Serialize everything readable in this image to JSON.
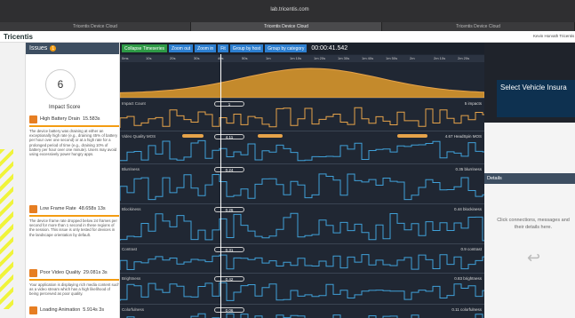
{
  "browser": {
    "url": "lab.tricentis.com",
    "tabs": [
      "Tricentis Device Cloud",
      "Tricentis Device Cloud",
      "Tricentis Device Cloud"
    ],
    "active_tab": 1
  },
  "app": {
    "brand": "Tricentis",
    "user": "Kevin Horvath Tricentis"
  },
  "issues": {
    "title": "Issues",
    "count": "1",
    "score": "6",
    "score_label": "Impact Score",
    "cards": [
      {
        "title": "High Battery Drain",
        "time": "15.583s",
        "text": "The device battery was draining at either an exceptionally high rate (e.g., draining 45% of battery per hour over one second) or at a high rate for a prolonged period of time (e.g., draining 10% of battery per hour over one minute). Users may avoid using excessively power hungry apps."
      },
      {
        "title": "Low Frame Rate",
        "time": "48.658s 13s",
        "text": "The device frame rate dropped below 24 frames per second for more than 1 second in these regions of the session. This issue is only tested for devices in the landscape orientation by default."
      },
      {
        "title": "Poor Video Quality",
        "time": "29.081s 3s",
        "text": "Your application is displaying rich media content such as a video stream which has a high likelihood of being perceived as poor quality."
      },
      {
        "title": "Loading Animation",
        "time": "5.914s 3s",
        "text": ""
      }
    ]
  },
  "toolbar": {
    "collapse": "Collapse Timeseries",
    "zoom_out": "Zoom out",
    "zoom_in": "Zoom in",
    "fit": "Fit",
    "group_host": "Group by host",
    "group_cat": "Group by category",
    "timer": "00:00:41.542"
  },
  "ticks": [
    "0ms",
    "10s",
    "20s",
    "30s",
    "40s",
    "50s",
    "1m",
    "1m 10s",
    "1m 20s",
    "1m 30s",
    "1m 40s",
    "1m 50s",
    "2m",
    "2m 10s",
    "2m 20s"
  ],
  "lanes": [
    {
      "name": "Impact Count",
      "value": "1",
      "right": "5 impacts"
    },
    {
      "name": "Video Quality MOS",
      "value": "4.11",
      "right": "4.67 HeadSpin MOS"
    },
    {
      "name": "Blurriness",
      "value": "0.24",
      "right": "0.35 blurriness"
    },
    {
      "name": "Blockiness",
      "value": "0.26",
      "right": "0.44 blockiness"
    },
    {
      "name": "Contrast",
      "value": "0.31",
      "right": "0.9 contrast"
    },
    {
      "name": "Brightness",
      "value": "0.42",
      "right": "0.83 brightness"
    },
    {
      "name": "Colorfulness",
      "value": "0.06",
      "right": "0.11 colorfulness"
    }
  ],
  "details": {
    "title": "Details",
    "hint": "Click connections, messages and their details here.",
    "preview_title": "Select Vehicle Insura"
  }
}
